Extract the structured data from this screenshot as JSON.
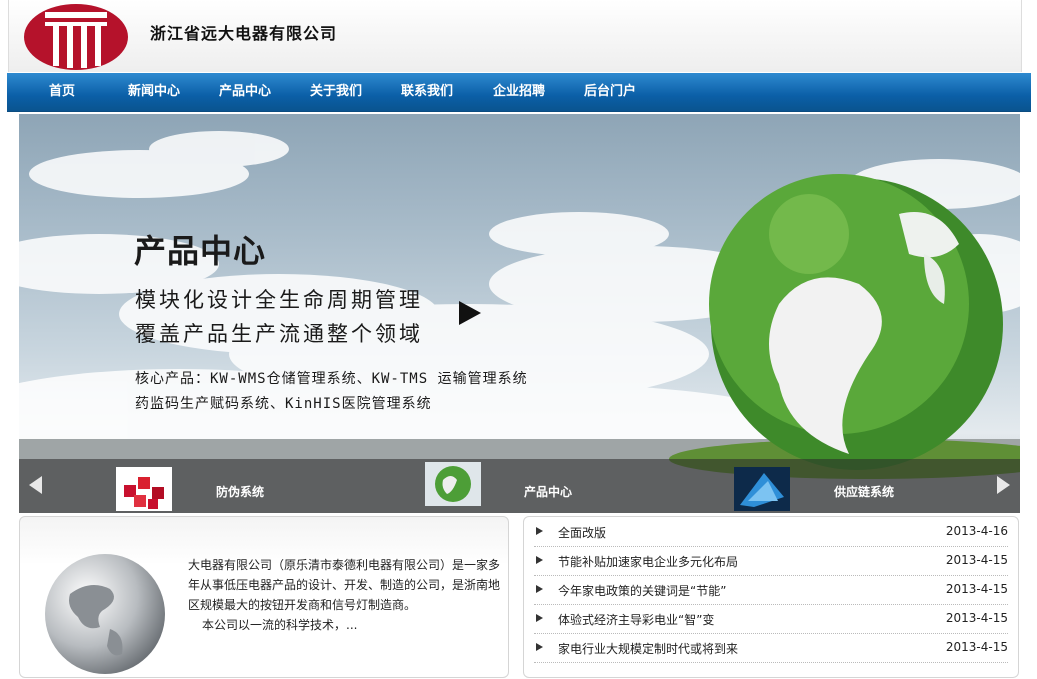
{
  "header": {
    "company_name": "浙江省远大电器有限公司"
  },
  "nav": {
    "items": [
      "首页",
      "新闻中心",
      "产品中心",
      "关于我们",
      "联系我们",
      "企业招聘",
      "后台门户"
    ]
  },
  "banner": {
    "title": "产品中心",
    "line1": "模块化设计全生命周期管理",
    "line2": "覆盖产品生产流通整个领域",
    "core1": "核心产品：KW-WMS仓储管理系统、KW-TMS 运输管理系统",
    "core2": "药监码生产赋码系统、KinHIS医院管理系统",
    "thumbs": [
      "防伪系统",
      "产品中心",
      "供应链系统"
    ]
  },
  "about": {
    "text_p1": "大电器有限公司（原乐清市泰德利电器有限公司）是一家多年从事低压电器产品的设计、开发、制造的公司，是浙南地区规模最大的按钮开发商和信号灯制造商。",
    "text_p2": "本公司以一流的科学技术，..."
  },
  "news": {
    "items": [
      {
        "title": "全面改版",
        "date": "2013-4-16"
      },
      {
        "title": "节能补贴加速家电企业多元化布局",
        "date": "2013-4-15"
      },
      {
        "title": "今年家电政策的关键词是“节能”",
        "date": "2013-4-15"
      },
      {
        "title": "体验式经济主导彩电业“智”变",
        "date": "2013-4-15"
      },
      {
        "title": "家电行业大规模定制时代或将到来",
        "date": "2013-4-15"
      }
    ]
  },
  "colors": {
    "nav_blue": "#0b5fa7",
    "logo_red": "#b5122b"
  }
}
